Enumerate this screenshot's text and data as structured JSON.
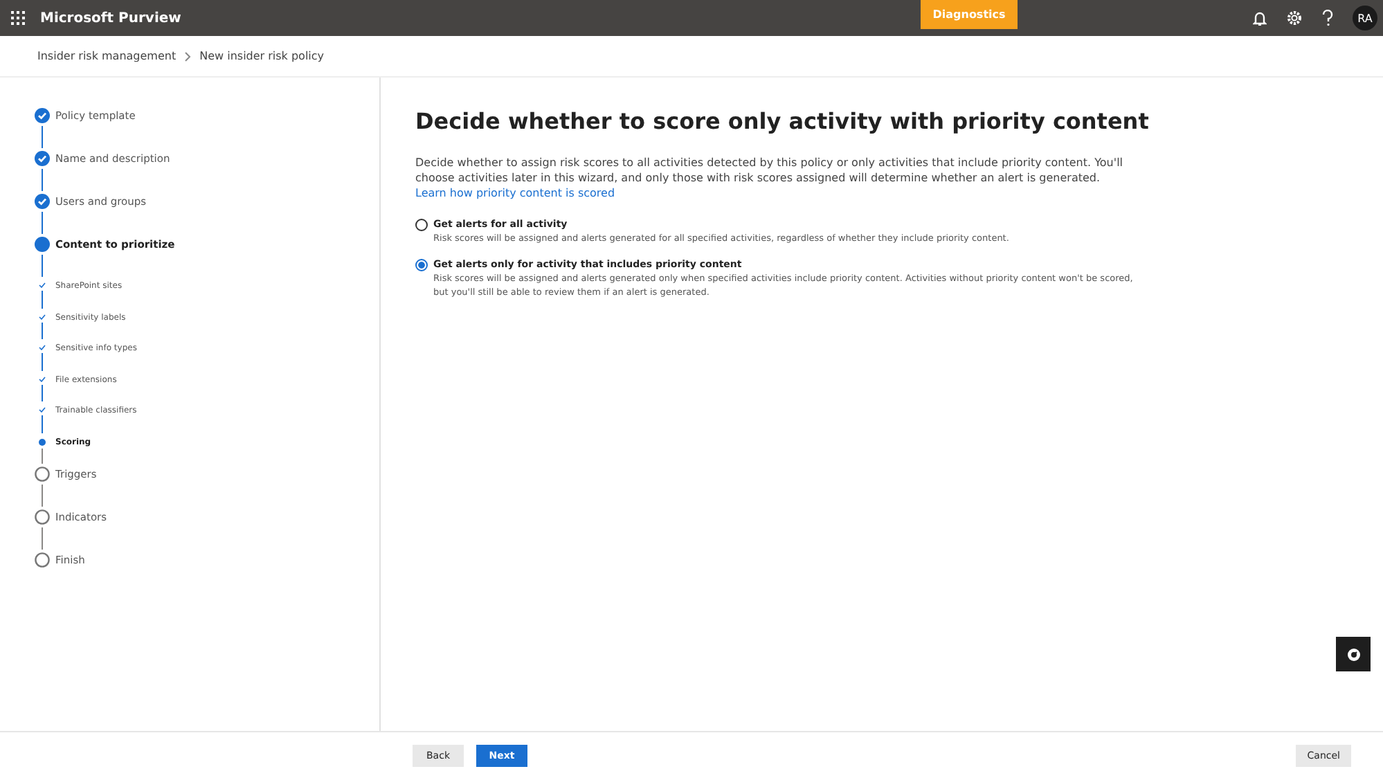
{
  "header": {
    "app_title": "Microsoft Purview",
    "diagnostics": "Diagnostics",
    "avatar": "RA"
  },
  "breadcrumb": [
    "Insider risk management",
    "New insider risk policy"
  ],
  "steps": [
    {
      "kind": "step",
      "label": "Policy template",
      "completed": true,
      "selected": false
    },
    {
      "kind": "step",
      "label": "Name and description",
      "completed": true,
      "selected": false
    },
    {
      "kind": "step",
      "label": "Users and groups",
      "completed": true,
      "selected": false
    },
    {
      "kind": "step",
      "label": "Content to prioritize",
      "completed": false,
      "selected": true
    },
    {
      "kind": "substep",
      "label": "SharePoint sites",
      "completed": true,
      "selected": false
    },
    {
      "kind": "substep",
      "label": "Sensitivity labels",
      "completed": true,
      "selected": false
    },
    {
      "kind": "substep",
      "label": "Sensitive info types",
      "completed": true,
      "selected": false
    },
    {
      "kind": "substep",
      "label": "File extensions",
      "completed": true,
      "selected": false
    },
    {
      "kind": "substep",
      "label": "Trainable classifiers",
      "completed": true,
      "selected": false
    },
    {
      "kind": "substep",
      "label": "Scoring",
      "completed": false,
      "selected": true
    },
    {
      "kind": "step",
      "label": "Triggers",
      "completed": false,
      "selected": false
    },
    {
      "kind": "step",
      "label": "Indicators",
      "completed": false,
      "selected": false
    },
    {
      "kind": "step",
      "label": "Finish",
      "completed": false,
      "selected": false
    }
  ],
  "page": {
    "title": "Decide whether to score only activity with priority content",
    "description": "Decide whether to assign risk scores to all activities detected by this policy or only activities that include priority content. You'll choose activities later in this wizard, and only those with risk scores assigned will determine whether an alert is generated.",
    "link": "Learn how priority content is scored",
    "options": [
      {
        "label": "Get alerts for all activity",
        "description": "Risk scores will be assigned and alerts generated for all specified activities, regardless of whether they include priority content.",
        "selected": false
      },
      {
        "label": "Get alerts only for activity that includes priority content",
        "description": "Risk scores will be assigned and alerts generated only when specified activities include priority content. Activities without priority content won't be scored, but you'll still be able to review them if an alert is generated.",
        "selected": true
      }
    ]
  },
  "footer": {
    "back": "Back",
    "next": "Next",
    "cancel": "Cancel"
  }
}
